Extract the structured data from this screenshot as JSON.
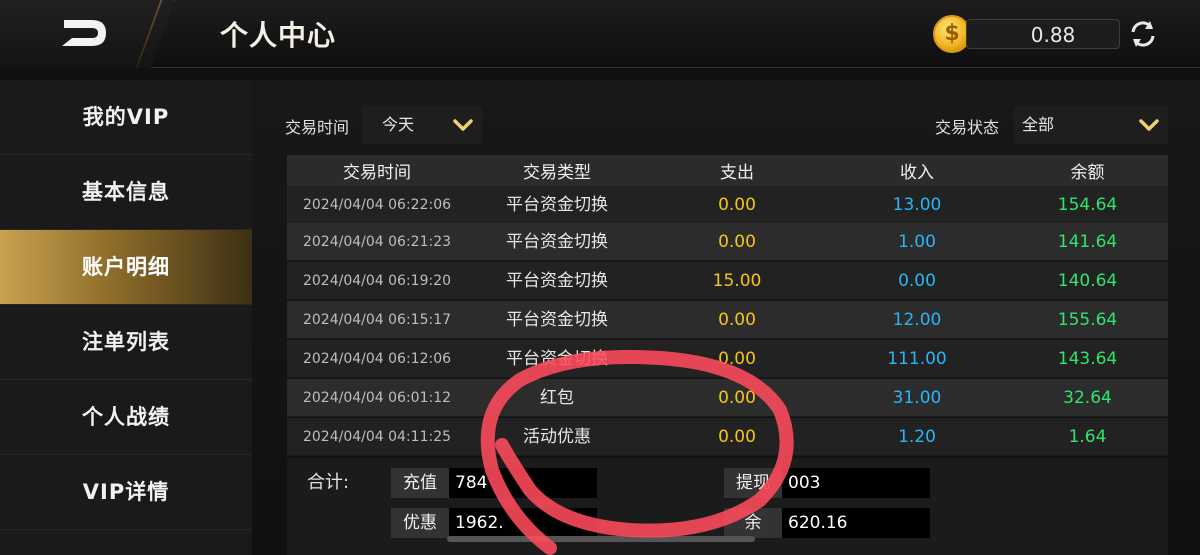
{
  "header": {
    "title": "个人中心",
    "balance": "0.88",
    "coin_symbol": "$"
  },
  "sidebar": {
    "items": [
      {
        "label": "我的VIP"
      },
      {
        "label": "基本信息"
      },
      {
        "label": "账户明细"
      },
      {
        "label": "注单列表"
      },
      {
        "label": "个人战绩"
      },
      {
        "label": "VIP详情"
      }
    ],
    "active_index": 2
  },
  "filters": {
    "time_label": "交易时间",
    "time_value": "今天",
    "status_label": "交易状态",
    "status_value": "全部"
  },
  "table": {
    "columns": [
      "交易时间",
      "交易类型",
      "支出",
      "收入",
      "余额"
    ],
    "rows": [
      {
        "time": "2024/04/04 06:22:06",
        "type": "平台资金切换",
        "out": "0.00",
        "in": "13.00",
        "balance": "154.64"
      },
      {
        "time": "2024/04/04 06:21:23",
        "type": "平台资金切换",
        "out": "0.00",
        "in": "1.00",
        "balance": "141.64"
      },
      {
        "time": "2024/04/04 06:19:20",
        "type": "平台资金切换",
        "out": "15.00",
        "in": "0.00",
        "balance": "140.64"
      },
      {
        "time": "2024/04/04 06:15:17",
        "type": "平台资金切换",
        "out": "0.00",
        "in": "12.00",
        "balance": "155.64"
      },
      {
        "time": "2024/04/04 06:12:06",
        "type": "平台资金切换",
        "out": "0.00",
        "in": "111.00",
        "balance": "143.64"
      },
      {
        "time": "2024/04/04 06:01:12",
        "type": "红包",
        "out": "0.00",
        "in": "31.00",
        "balance": "32.64"
      },
      {
        "time": "2024/04/04 04:11:25",
        "type": "活动优惠",
        "out": "0.00",
        "in": "1.20",
        "balance": "1.64"
      }
    ]
  },
  "summary": {
    "label": "合计:",
    "recharge_label": "充值",
    "recharge_value": "784",
    "withdraw_label": "提现",
    "withdraw_value": "003",
    "discount_label": "优惠",
    "discount_value": "1962.",
    "balance_label": "余",
    "balance_value": "620.16"
  },
  "colors": {
    "accent_gold": "#c9a250",
    "out_yellow": "#f5c518",
    "in_blue": "#29b6f6",
    "balance_green": "#2ee66b",
    "annotation_red": "#ff4b5c"
  }
}
